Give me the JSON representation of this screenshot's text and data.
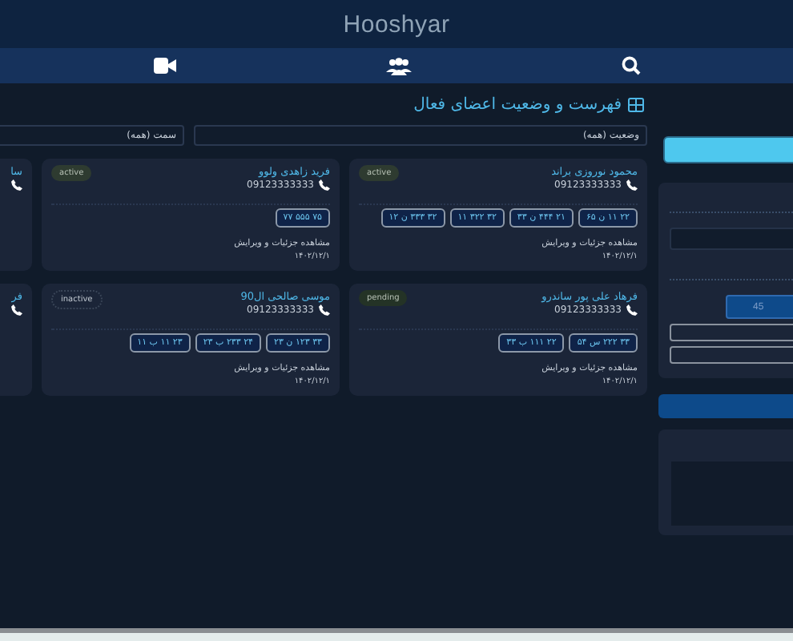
{
  "header": {
    "logo": "Hooshyar"
  },
  "title": "فهرست و وضعیت اعضای فعال",
  "filters": [
    {
      "value": "وضعیت (همه)"
    },
    {
      "value": "سمت (همه)"
    }
  ],
  "members": [
    {
      "name": "محمود نوروزی براند",
      "phone": "09123333333",
      "status": {
        "text": "active",
        "kind": "success"
      },
      "plates": [
        "۲۲ ۱۱ ن ۶۵",
        "۲۱ ۴۴۴ ن ۳۳",
        "۳۲ ۳۲۲ ۱۱",
        "۳۲ ۳۳۳ ن ۱۲"
      ],
      "link": "مشاهده جزئیات و ویرایش",
      "date": "۱۴۰۲/۱۲/۱"
    },
    {
      "name": "فرید زاهدی ولوو",
      "phone": "09123333333",
      "status": {
        "text": "active",
        "kind": "success"
      },
      "plates": [
        "۷۵ ۵۵۵ ۷۷"
      ],
      "link": "مشاهده جزئیات و ویرایش",
      "date": "۱۴۰۲/۱۲/۱"
    },
    {
      "name": "سا"
    },
    {
      "name": "فرهاد علی پور ساندرو",
      "phone": "09123333333",
      "status": {
        "text": "pending",
        "kind": "warning"
      },
      "plates": [
        "۳۳ ۲۲۲ س ۵۴",
        "۲۲ ۱۱۱ ب ۳۳"
      ],
      "link": "مشاهده جزئیات و ویرایش",
      "date": "۱۴۰۲/۱۲/۱"
    },
    {
      "name": "موسی صالحی ال90",
      "phone": "09123333333",
      "status": {
        "text": "inactive",
        "kind": "muted"
      },
      "plates": [
        "۳۳ ۱۲۳ ن ۲۳",
        "۲۴ ۲۳۳ ب ۲۳",
        "۲۳ ۱۱ ب ۱۱"
      ],
      "link": "مشاهده جزئیات و ویرایش",
      "date": "۱۴۰۲/۱۲/۱"
    },
    {
      "name": "فر"
    }
  ],
  "sidebar": {
    "count_button": "45"
  }
}
